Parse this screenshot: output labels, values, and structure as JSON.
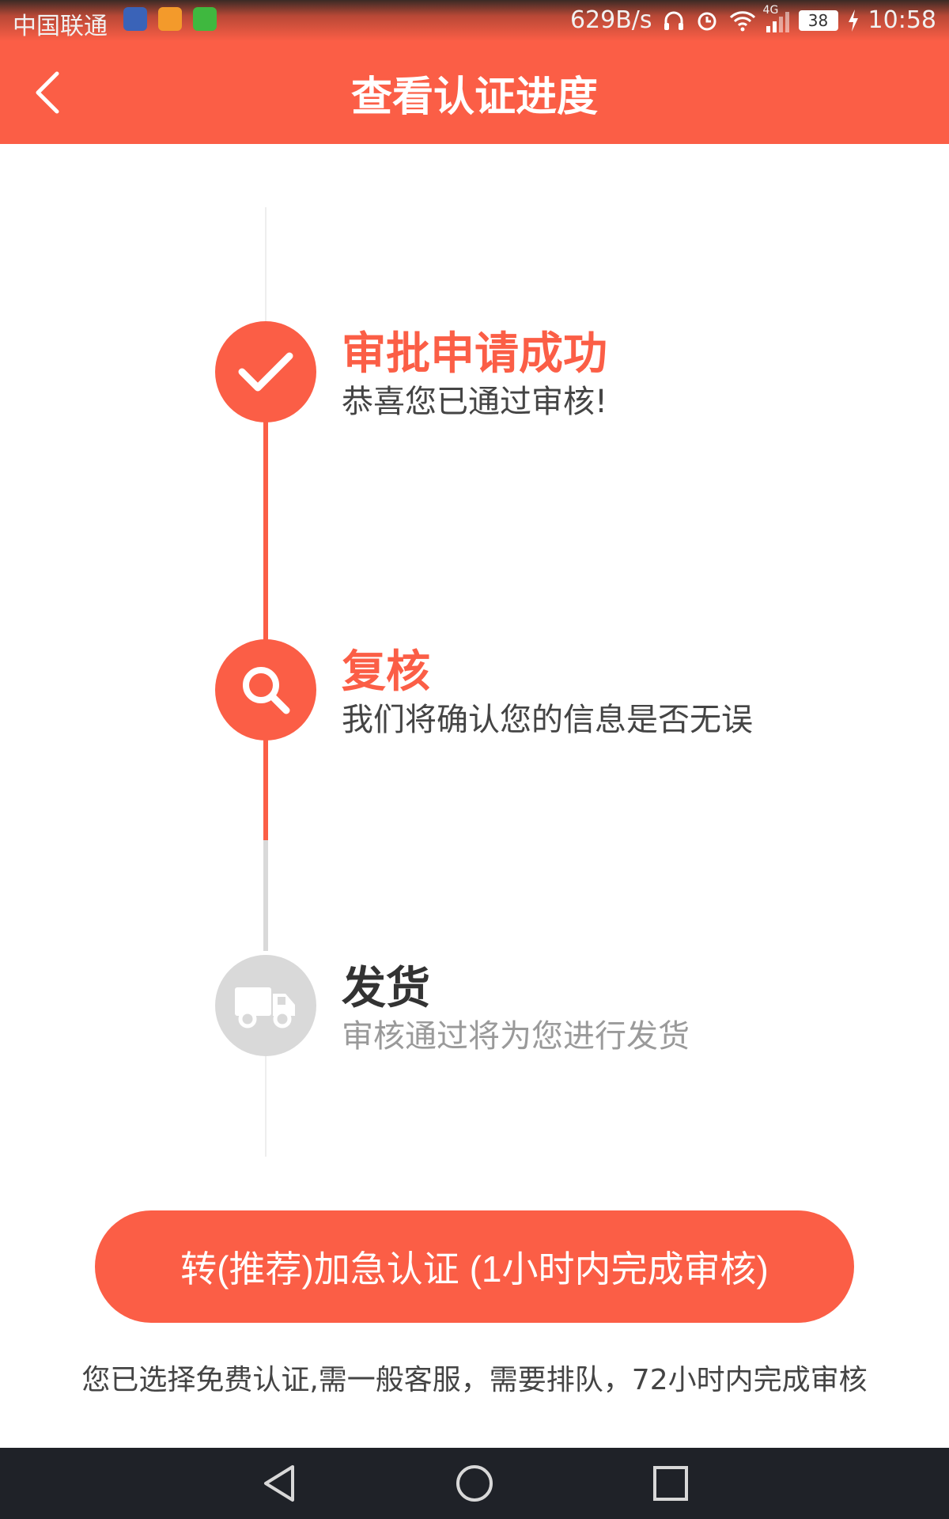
{
  "status_bar": {
    "carrier": "中国联通",
    "network_speed": "629B/s",
    "network_type": "4G",
    "battery": "38",
    "time": "10:58"
  },
  "app_bar": {
    "title": "查看认证进度",
    "back_icon": "chevron-left-icon"
  },
  "colors": {
    "accent": "#fb5e46",
    "inactive": "#d9d9d9",
    "text_dark": "#333333",
    "text_muted": "#9a9a9a"
  },
  "steps": [
    {
      "title": "审批申请成功",
      "description": "恭喜您已通过审核!",
      "icon": "check-icon",
      "state": "done"
    },
    {
      "title": "复核",
      "description": "我们将确认您的信息是否无误",
      "icon": "search-icon",
      "state": "current"
    },
    {
      "title": "发货",
      "description": "审核通过将为您进行发货",
      "icon": "truck-icon",
      "state": "pending"
    }
  ],
  "action": {
    "label": "转(推荐)加急认证 (1小时内完成审核)"
  },
  "note": "您已选择免费认证,需一般客服，需要排队，72小时内完成审核",
  "nav_bar": {
    "back_icon": "triangle-back-icon",
    "home_icon": "circle-home-icon",
    "recents_icon": "square-recents-icon"
  }
}
